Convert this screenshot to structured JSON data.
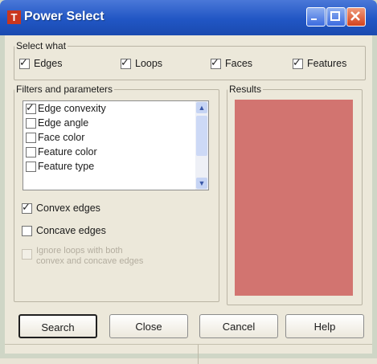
{
  "window": {
    "title": "Power Select",
    "app_icon": "T",
    "minimize": "minimize-icon",
    "maximize": "maximize-icon",
    "close": "close-icon"
  },
  "select_what": {
    "legend": "Select what",
    "options": [
      {
        "label": "Edges",
        "checked": true
      },
      {
        "label": "Loops",
        "checked": true
      },
      {
        "label": "Faces",
        "checked": true
      },
      {
        "label": "Features",
        "checked": true
      }
    ]
  },
  "filters": {
    "legend": "Filters and parameters",
    "items": [
      {
        "label": "Edge convexity",
        "checked": true
      },
      {
        "label": "Edge angle",
        "checked": false
      },
      {
        "label": "Face color",
        "checked": false
      },
      {
        "label": "Feature color",
        "checked": false
      },
      {
        "label": "Feature type",
        "checked": false
      }
    ],
    "convex_edges": {
      "label": "Convex edges",
      "checked": true
    },
    "concave_edges": {
      "label": "Concave edges",
      "checked": false
    },
    "ignore_loops": {
      "label_line1": "Ignore loops with both",
      "label_line2": "convex and concave edges",
      "checked": false,
      "disabled": true
    }
  },
  "results": {
    "legend": "Results",
    "color": "#d27470"
  },
  "buttons": {
    "search": "Search",
    "close": "Close",
    "cancel": "Cancel",
    "help": "Help"
  },
  "colors": {
    "titlebar": "#2156c4",
    "close_button": "#d2431f"
  }
}
